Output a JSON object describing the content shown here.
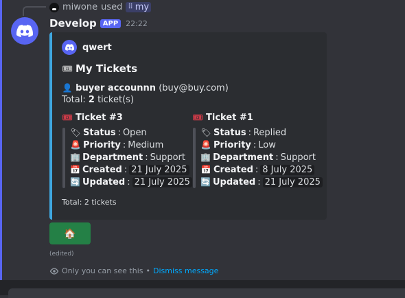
{
  "reply": {
    "user": "miwone",
    "used": "used",
    "command": "my"
  },
  "message": {
    "author": "Develop",
    "badge": "APP",
    "time": "22:22",
    "edited": "(edited)"
  },
  "embed": {
    "accent_color": "#3fa7e0",
    "author": "qwert",
    "title": "My Tickets",
    "user_name": "buyer accounnn",
    "user_email": "(buy@buy.com)",
    "total_prefix": "Total:",
    "total_count": "2",
    "total_suffix": "ticket(s)",
    "fields": [
      {
        "name": "Ticket #3",
        "status_label": "Status",
        "status": "Open",
        "priority_label": "Priority",
        "priority": "Medium",
        "department_label": "Department",
        "department": "Support",
        "created_label": "Created",
        "created": "21 July 2025",
        "updated_label": "Updated",
        "updated": "21 July 2025"
      },
      {
        "name": "Ticket #1",
        "status_label": "Status",
        "status": "Replied",
        "priority_label": "Priority",
        "priority": "Low",
        "department_label": "Department",
        "department": "Support",
        "created_label": "Created",
        "created": "8 July 2025",
        "updated_label": "Updated",
        "updated": "21 July 2025"
      }
    ],
    "footer": "Total: 2 tickets"
  },
  "button": {
    "icon": "house-icon",
    "glyph": "🏠",
    "color": "#248046"
  },
  "ephemeral": {
    "notice": "Only you can see this",
    "separator": "•",
    "dismiss": "Dismiss message"
  },
  "colors": {
    "brand": "#5865f2",
    "background": "#323339",
    "embed_bg": "#2b2d31"
  }
}
